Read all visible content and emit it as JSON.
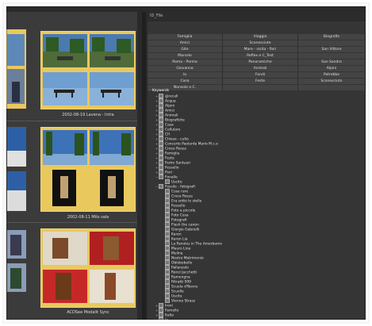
{
  "browser": {
    "groups": [
      {
        "caption": "2002-08-19 Lavena - Intra"
      },
      {
        "caption": "2002-08-11 Milo sala"
      },
      {
        "caption": "ACDSee Modalit Sync"
      }
    ]
  },
  "panel": {
    "title": "ID_File",
    "tag_rows": [
      [
        "Famiglia",
        "Viaggio",
        "Biografie"
      ],
      [
        "Amici",
        "Sconosciute",
        ""
      ],
      [
        "Gite",
        "Mare - visita - fiori",
        "San Vittore"
      ],
      [
        "Marcelo",
        "Reflex e C_Test",
        ""
      ],
      [
        "Roma - Parma",
        "Panoramiche",
        "San Sandro"
      ],
      [
        "Giovanna",
        "Animali",
        "Alpini"
      ],
      [
        "Io",
        "Fondi",
        "Potrebbe"
      ],
      [
        "Casa",
        "Feste",
        "Sconosciuto"
      ],
      [
        "Nonsolo e C.",
        "",
        ""
      ]
    ],
    "tree_root": "Keywords",
    "tree_items": [
      {
        "label": "@recall",
        "level": 1,
        "expander": "+"
      },
      {
        "label": "Acqua",
        "level": 1,
        "expander": "+"
      },
      {
        "label": "Alpini",
        "level": 1,
        "expander": "+"
      },
      {
        "label": "Amici",
        "level": 1,
        "expander": "+"
      },
      {
        "label": "Animali",
        "level": 1,
        "expander": "+"
      },
      {
        "label": "Biografiche",
        "level": 1,
        "expander": "+"
      },
      {
        "label": "Casa",
        "level": 1,
        "expander": "+"
      },
      {
        "label": "Cellulare",
        "level": 1,
        "expander": "+"
      },
      {
        "label": "CH",
        "level": 1,
        "expander": "+"
      },
      {
        "label": "Chiese - culto",
        "level": 1,
        "expander": "+"
      },
      {
        "label": "Concerto Paolarda Mario M.c.o",
        "level": 1,
        "expander": "+"
      },
      {
        "label": "Croce Rossa",
        "level": 1,
        "expander": "+"
      },
      {
        "label": "Famiglia",
        "level": 1,
        "expander": "+"
      },
      {
        "label": "Feste",
        "level": 1,
        "expander": "+"
      },
      {
        "label": "Fedro Santuari",
        "level": 1,
        "expander": "+"
      },
      {
        "label": "Fessello",
        "level": 1,
        "expander": "+"
      },
      {
        "label": "Fiori",
        "level": 1,
        "expander": "+"
      },
      {
        "label": "Fonalle",
        "level": 1,
        "expander": "-"
      },
      {
        "label": "Uscite",
        "level": 2,
        "expander": ""
      },
      {
        "label": "Fossile - fotografi",
        "level": 1,
        "expander": "-"
      },
      {
        "label": "Cose rare",
        "level": 2,
        "expander": ""
      },
      {
        "label": "Croce Rossa",
        "level": 2,
        "expander": ""
      },
      {
        "label": "Era sotto le stelle",
        "level": 2,
        "expander": ""
      },
      {
        "label": "Fessello",
        "level": 2,
        "expander": ""
      },
      {
        "label": "Foto a piccole",
        "level": 2,
        "expander": ""
      },
      {
        "label": "Foto Cosa",
        "level": 2,
        "expander": ""
      },
      {
        "label": "Fotografi",
        "level": 2,
        "expander": ""
      },
      {
        "label": "Flash the canon",
        "level": 2,
        "expander": ""
      },
      {
        "label": "Giorgio Gabrielli",
        "level": 2,
        "expander": ""
      },
      {
        "label": "Karen",
        "level": 2,
        "expander": ""
      },
      {
        "label": "Karen Lia",
        "level": 2,
        "expander": ""
      },
      {
        "label": "La Panoles in The Amerbamo",
        "level": 2,
        "expander": ""
      },
      {
        "label": "Mauro Lina",
        "level": 2,
        "expander": ""
      },
      {
        "label": "Mulina",
        "level": 2,
        "expander": ""
      },
      {
        "label": "Nostro Matrimonio",
        "level": 2,
        "expander": ""
      },
      {
        "label": "Oblobobello",
        "level": 2,
        "expander": ""
      },
      {
        "label": "Pallanzolo",
        "level": 2,
        "expander": ""
      },
      {
        "label": "Renzi Jacchetti",
        "level": 2,
        "expander": ""
      },
      {
        "label": "Ramengna",
        "level": 2,
        "expander": ""
      },
      {
        "label": "Ritratti 999",
        "level": 2,
        "expander": ""
      },
      {
        "label": "Scuola d'Nevra",
        "level": 2,
        "expander": ""
      },
      {
        "label": "Scuolle",
        "level": 2,
        "expander": ""
      },
      {
        "label": "Uscite",
        "level": 2,
        "expander": ""
      },
      {
        "label": "Vienna Strass",
        "level": 2,
        "expander": ""
      },
      {
        "label": "Ironi",
        "level": 1,
        "expander": "+"
      },
      {
        "label": "Farnello",
        "level": 1,
        "expander": "+"
      },
      {
        "label": "Italia",
        "level": 1,
        "expander": "+"
      },
      {
        "label": "Io",
        "level": 1,
        "expander": "+"
      }
    ]
  },
  "colors": {
    "accent": "#e9c85e",
    "panel_bg": "#353535",
    "browser_bg": "#3b3b3b"
  }
}
